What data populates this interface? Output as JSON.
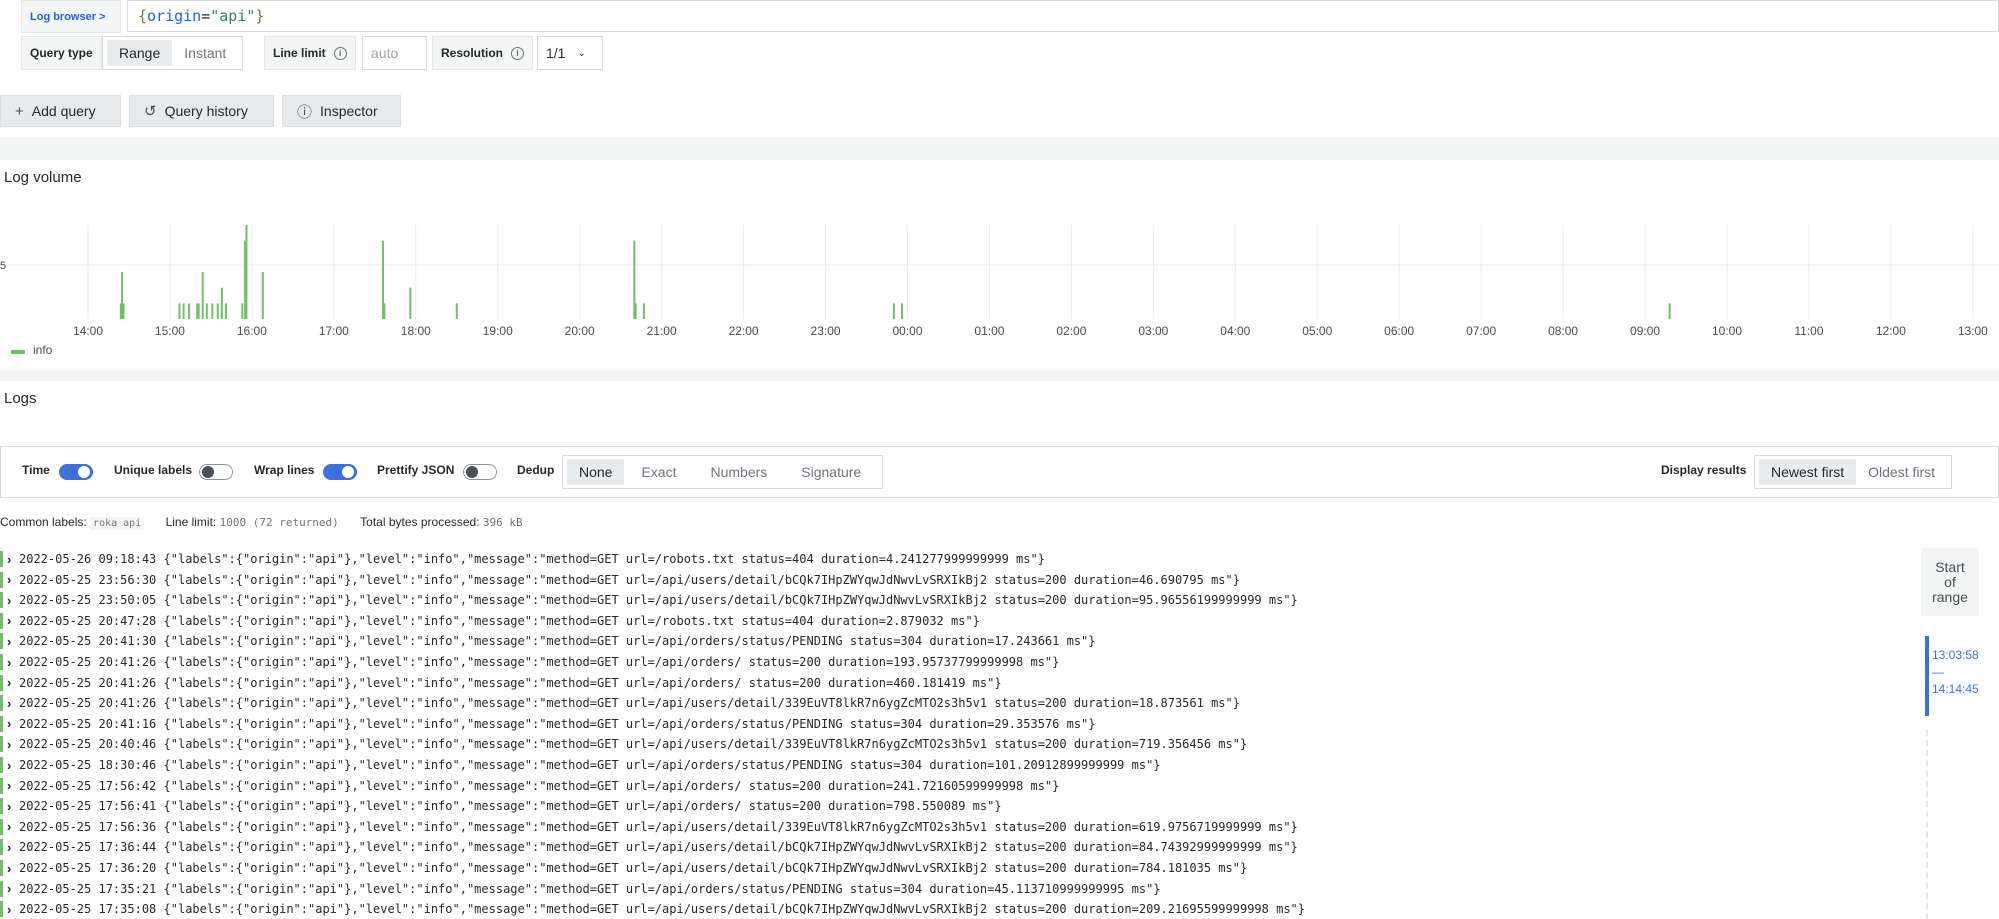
{
  "query": {
    "datasource_link": "Log browser >",
    "expression_brace_open": "{",
    "expression_key": "origin",
    "expression_eq": "=",
    "expression_val": "\"api\"",
    "expression_brace_close": "}"
  },
  "options": {
    "query_type_label": "Query type",
    "query_types": [
      "Range",
      "Instant"
    ],
    "query_type_selected": "Range",
    "line_limit_label": "Line limit",
    "line_limit_placeholder": "auto",
    "resolution_label": "Resolution",
    "resolution_value": "1/1"
  },
  "toolbar": {
    "add_query": "Add query",
    "query_history": "Query history",
    "inspector": "Inspector"
  },
  "log_volume": {
    "title": "Log volume",
    "y_tick": "5",
    "legend": "info",
    "series_color": "#73bf69"
  },
  "chart_data": {
    "type": "bar",
    "title": "Log volume",
    "x": [
      "14:00",
      "15:00",
      "16:00",
      "17:00",
      "18:00",
      "19:00",
      "20:00",
      "21:00",
      "22:00",
      "23:00",
      "00:00",
      "01:00",
      "02:00",
      "03:00",
      "04:00",
      "05:00",
      "06:00",
      "07:00",
      "08:00",
      "09:00",
      "10:00",
      "11:00",
      "12:00",
      "13:00"
    ],
    "series": [
      {
        "name": "info",
        "points": [
          {
            "t": "14:24",
            "v": 1
          },
          {
            "t": "14:25",
            "v": 3
          },
          {
            "t": "14:26",
            "v": 1
          },
          {
            "t": "15:07",
            "v": 1
          },
          {
            "t": "15:10",
            "v": 1
          },
          {
            "t": "15:14",
            "v": 1
          },
          {
            "t": "15:20",
            "v": 1
          },
          {
            "t": "15:21",
            "v": 1
          },
          {
            "t": "15:24",
            "v": 3
          },
          {
            "t": "15:27",
            "v": 1
          },
          {
            "t": "15:31",
            "v": 1
          },
          {
            "t": "15:35",
            "v": 1
          },
          {
            "t": "15:38",
            "v": 2
          },
          {
            "t": "15:41",
            "v": 1
          },
          {
            "t": "15:53",
            "v": 1
          },
          {
            "t": "15:55",
            "v": 5
          },
          {
            "t": "15:56",
            "v": 6
          },
          {
            "t": "16:08",
            "v": 3
          },
          {
            "t": "17:36",
            "v": 5
          },
          {
            "t": "17:37",
            "v": 1
          },
          {
            "t": "17:56",
            "v": 2
          },
          {
            "t": "18:30",
            "v": 1
          },
          {
            "t": "20:40",
            "v": 5
          },
          {
            "t": "20:41",
            "v": 1
          },
          {
            "t": "20:47",
            "v": 1
          },
          {
            "t": "23:50",
            "v": 1
          },
          {
            "t": "23:56",
            "v": 1
          },
          {
            "t": "09:18",
            "v": 1
          }
        ]
      }
    ],
    "ylim": [
      0,
      6
    ],
    "grid": true,
    "legend": "bottom-left"
  },
  "logs": {
    "title": "Logs",
    "opt_time": "Time",
    "opt_unique": "Unique labels",
    "opt_wrap": "Wrap lines",
    "opt_prettify": "Prettify JSON",
    "dedup_label": "Dedup",
    "dedup_options": [
      "None",
      "Exact",
      "Numbers",
      "Signature"
    ],
    "dedup_selected": "None",
    "display_label": "Display results",
    "order_options": [
      "Newest first",
      "Oldest first"
    ],
    "order_selected": "Newest first",
    "common_labels_label": "Common labels:",
    "common_labels_value": "roka api",
    "line_limit_label": "Line limit:",
    "line_limit_value": "1000 (72 returned)",
    "bytes_label": "Total bytes processed:",
    "bytes_value": "396 kB",
    "range_start": [
      "Start",
      "of",
      "range"
    ],
    "range_from": "13:03:58",
    "range_dash": "—",
    "range_to": "14:14:45",
    "rows": [
      {
        "ts": "2022-05-26 09:18:43",
        "line": "{\"labels\":{\"origin\":\"api\"},\"level\":\"info\",\"message\":\"method=GET url=/robots.txt status=404 duration=4.241277999999999 ms\"}"
      },
      {
        "ts": "2022-05-25 23:56:30",
        "line": "{\"labels\":{\"origin\":\"api\"},\"level\":\"info\",\"message\":\"method=GET url=/api/users/detail/bCQk7IHpZWYqwJdNwvLvSRXIkBj2 status=200 duration=46.690795 ms\"}"
      },
      {
        "ts": "2022-05-25 23:50:05",
        "line": "{\"labels\":{\"origin\":\"api\"},\"level\":\"info\",\"message\":\"method=GET url=/api/users/detail/bCQk7IHpZWYqwJdNwvLvSRXIkBj2 status=200 duration=95.96556199999999 ms\"}"
      },
      {
        "ts": "2022-05-25 20:47:28",
        "line": "{\"labels\":{\"origin\":\"api\"},\"level\":\"info\",\"message\":\"method=GET url=/robots.txt status=404 duration=2.879032 ms\"}"
      },
      {
        "ts": "2022-05-25 20:41:30",
        "line": "{\"labels\":{\"origin\":\"api\"},\"level\":\"info\",\"message\":\"method=GET url=/api/orders/status/PENDING status=304 duration=17.243661 ms\"}"
      },
      {
        "ts": "2022-05-25 20:41:26",
        "line": "{\"labels\":{\"origin\":\"api\"},\"level\":\"info\",\"message\":\"method=GET url=/api/orders/ status=200 duration=193.95737799999998 ms\"}"
      },
      {
        "ts": "2022-05-25 20:41:26",
        "line": "{\"labels\":{\"origin\":\"api\"},\"level\":\"info\",\"message\":\"method=GET url=/api/orders/ status=200 duration=460.181419 ms\"}"
      },
      {
        "ts": "2022-05-25 20:41:26",
        "line": "{\"labels\":{\"origin\":\"api\"},\"level\":\"info\",\"message\":\"method=GET url=/api/users/detail/339EuVT8lkR7n6ygZcMTO2s3h5v1 status=200 duration=18.873561 ms\"}"
      },
      {
        "ts": "2022-05-25 20:41:16",
        "line": "{\"labels\":{\"origin\":\"api\"},\"level\":\"info\",\"message\":\"method=GET url=/api/orders/status/PENDING status=304 duration=29.353576 ms\"}"
      },
      {
        "ts": "2022-05-25 20:40:46",
        "line": "{\"labels\":{\"origin\":\"api\"},\"level\":\"info\",\"message\":\"method=GET url=/api/users/detail/339EuVT8lkR7n6ygZcMTO2s3h5v1 status=200 duration=719.356456 ms\"}"
      },
      {
        "ts": "2022-05-25 18:30:46",
        "line": "{\"labels\":{\"origin\":\"api\"},\"level\":\"info\",\"message\":\"method=GET url=/api/orders/status/PENDING status=304 duration=101.20912899999999 ms\"}"
      },
      {
        "ts": "2022-05-25 17:56:42",
        "line": "{\"labels\":{\"origin\":\"api\"},\"level\":\"info\",\"message\":\"method=GET url=/api/orders/ status=200 duration=241.72160599999998 ms\"}"
      },
      {
        "ts": "2022-05-25 17:56:41",
        "line": "{\"labels\":{\"origin\":\"api\"},\"level\":\"info\",\"message\":\"method=GET url=/api/orders/ status=200 duration=798.550089 ms\"}"
      },
      {
        "ts": "2022-05-25 17:56:36",
        "line": "{\"labels\":{\"origin\":\"api\"},\"level\":\"info\",\"message\":\"method=GET url=/api/users/detail/339EuVT8lkR7n6ygZcMTO2s3h5v1 status=200 duration=619.9756719999999 ms\"}"
      },
      {
        "ts": "2022-05-25 17:36:44",
        "line": "{\"labels\":{\"origin\":\"api\"},\"level\":\"info\",\"message\":\"method=GET url=/api/users/detail/bCQk7IHpZWYqwJdNwvLvSRXIkBj2 status=200 duration=84.74392999999999 ms\"}"
      },
      {
        "ts": "2022-05-25 17:36:20",
        "line": "{\"labels\":{\"origin\":\"api\"},\"level\":\"info\",\"message\":\"method=GET url=/api/users/detail/bCQk7IHpZWYqwJdNwvLvSRXIkBj2 status=200 duration=784.181035 ms\"}"
      },
      {
        "ts": "2022-05-25 17:35:21",
        "line": "{\"labels\":{\"origin\":\"api\"},\"level\":\"info\",\"message\":\"method=GET url=/api/orders/status/PENDING status=304 duration=45.113710999999995 ms\"}"
      },
      {
        "ts": "2022-05-25 17:35:08",
        "line": "{\"labels\":{\"origin\":\"api\"},\"level\":\"info\",\"message\":\"method=GET url=/api/users/detail/bCQk7IHpZWYqwJdNwvLvSRXIkBj2 status=200 duration=209.21695599999998 ms\"}"
      }
    ]
  }
}
